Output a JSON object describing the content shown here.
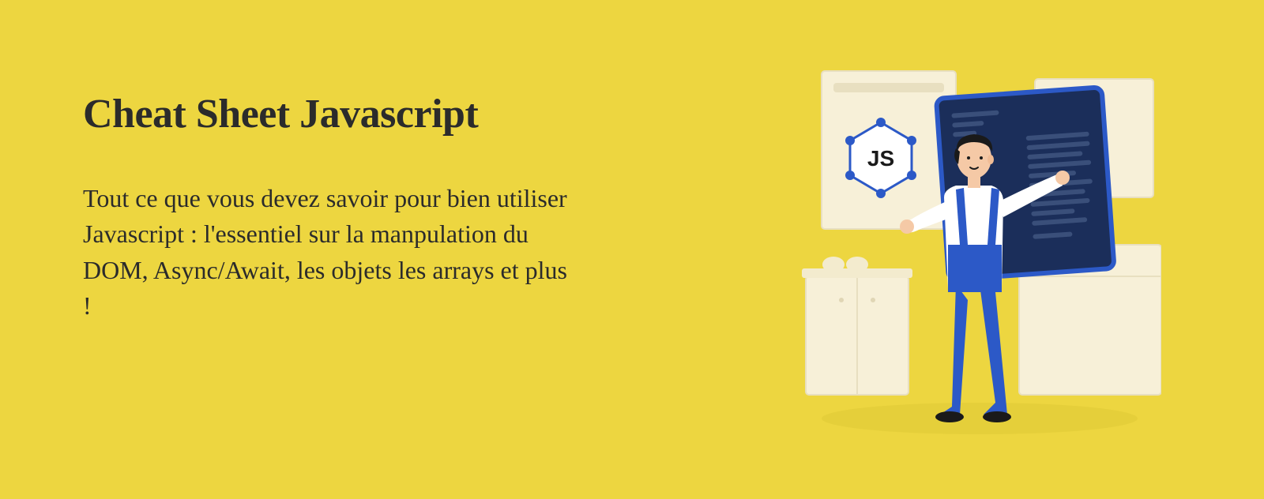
{
  "hero": {
    "title": "Cheat Sheet Javascript",
    "description": "Tout ce que vous devez savoir pour bien utiliser Javascript : l'essentiel sur la manpulation du DOM, Async/Await, les objets les arrays et plus !",
    "badge_text": "JS"
  },
  "colors": {
    "background": "#edd640",
    "text": "#2b2b2b",
    "screen": "#1b2e5a",
    "screen_border": "#2c59c7",
    "pants": "#2c59c7",
    "shirt": "#ffffff",
    "skin": "#f5c9a6",
    "hair": "#1a1a1a",
    "furniture": "#f7f0d8",
    "accent": "#2c59c7"
  }
}
